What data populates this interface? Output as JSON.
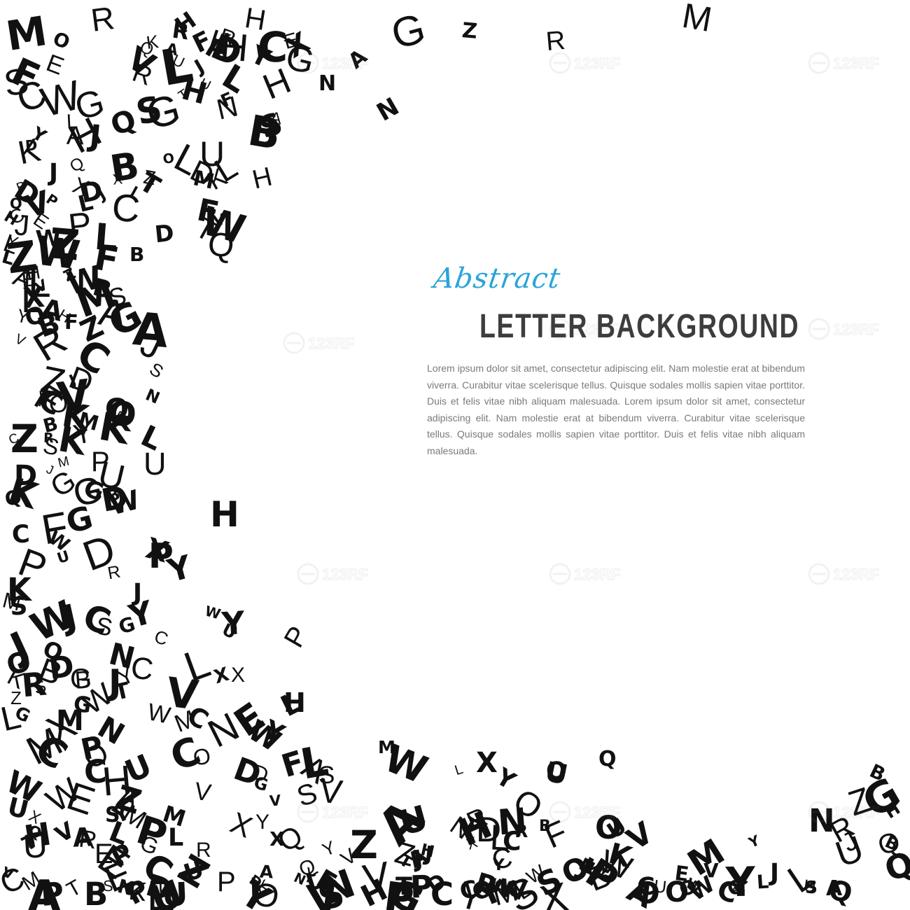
{
  "heading": {
    "script_word": "Abstract",
    "title": "LETTER BACKGROUND"
  },
  "body": {
    "paragraph": "Lorem ipsum dolor sit amet, consectetur adipiscing elit. Nam molestie erat at bibendum viverra. Curabitur vitae scelerisque tellus. Quisque sodales mollis sapien vitae porttitor. Duis et felis vitae nibh aliquam malesuada. Lorem ipsum dolor sit amet, consectetur adipiscing elit. Nam molestie erat at bibendum viverra. Curabitur vitae scelerisque tellus. Quisque sodales mollis sapien vitae porttitor. Duis et felis vitae nibh aliquam malesuada."
  },
  "colors": {
    "background": "#ffffff",
    "letters": "#111111",
    "accent": "#2aa4d9",
    "title": "#3d3d3d",
    "body_text": "#7a7a7a"
  },
  "decor": {
    "letter_glyphs": "ACGZHLMNRBXFDEJKPQSTUVWYO",
    "watermark": "123RF"
  }
}
